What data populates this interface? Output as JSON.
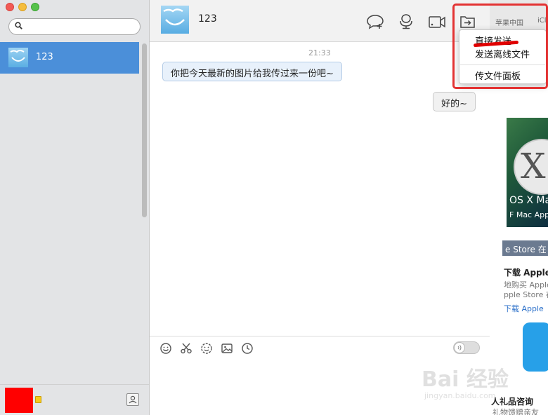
{
  "sidebar": {
    "search": {
      "value": "",
      "placeholder": ""
    },
    "contacts": [
      {
        "name": "123"
      }
    ]
  },
  "chat": {
    "header": {
      "name": "123"
    },
    "timestamp": "21:33",
    "messages": [
      {
        "direction": "in",
        "text": "你把今天最新的图片给我传过来一份吧~"
      },
      {
        "direction": "out",
        "text": "好的~"
      }
    ],
    "input": {
      "value": ""
    }
  },
  "file_menu": {
    "items": [
      {
        "label": "直接发送"
      },
      {
        "label": "发送离线文件"
      },
      {
        "label": "传文件面板"
      }
    ]
  },
  "browser_bg": {
    "tabs": [
      "苹果中国",
      "iCl"
    ],
    "banner_title": "OS X Ma",
    "banner_sub": "F Mac App",
    "store_bar": "e Store 在",
    "promo": [
      "下载 Apple",
      "地购买 Apple",
      "pple Store 在",
      "下载 Apple"
    ],
    "bottom": [
      "人礼品咨询",
      "礼物馈赠亲友"
    ]
  },
  "watermark": {
    "main": "Bai 经验",
    "sub": "jingyan.baidu.com"
  },
  "icons": {
    "search": "search-icon",
    "new_chat": "speech-bubble-plus-icon",
    "voice_call": "microphone-icon",
    "video_call": "video-camera-icon",
    "send_file": "file-send-icon",
    "emoji": "emoji-icon",
    "screenshot": "scissors-icon",
    "magic_emoji": "magic-face-icon",
    "image": "image-icon",
    "history": "clock-icon",
    "contacts": "contacts-icon"
  },
  "colors": {
    "selection": "#4b8fd9",
    "annotation": "#e33333",
    "bubble_in": "#e8f1fb"
  }
}
